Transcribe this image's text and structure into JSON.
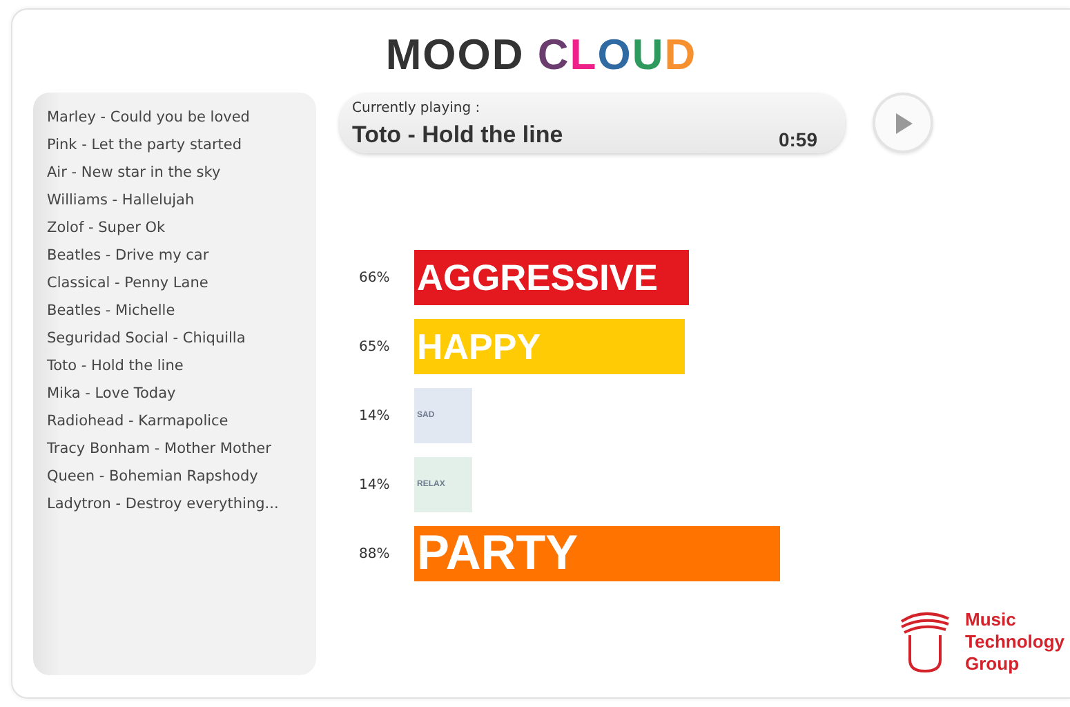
{
  "title": [
    {
      "text": "MOOD ",
      "color": "#333333"
    },
    {
      "text": "C",
      "color": "#6a3d6e"
    },
    {
      "text": "L",
      "color": "#f0208a"
    },
    {
      "text": "O",
      "color": "#2f6aa3"
    },
    {
      "text": "U",
      "color": "#2e9a5e"
    },
    {
      "text": "D",
      "color": "#f7912f"
    }
  ],
  "playlist": [
    "Marley - Could you be loved",
    "Pink - Let the party started",
    "Air - New  star in the sky",
    "Williams - Hallelujah",
    "Zolof - Super Ok",
    "Beatles - Drive my car",
    "Classical - Penny Lane",
    "Beatles - Michelle",
    "Seguridad Social - Chiquilla",
    "Toto - Hold the line",
    "Mika - Love Today",
    "Radiohead - Karmapolice",
    "Tracy Bonham - Mother Mother",
    "Queen - Bohemian Rapshody",
    "Ladytron - Destroy everything..."
  ],
  "now_playing": {
    "label": "Currently playing :",
    "track": "Toto - Hold the line",
    "time": "0:59"
  },
  "moods": [
    {
      "name": "AGGRESSIVE",
      "percent": "66%",
      "level": 0.66,
      "color": "#e3191f"
    },
    {
      "name": "HAPPY",
      "percent": "65%",
      "level": 0.65,
      "color": "#ffcb05"
    },
    {
      "name": "SAD",
      "percent": "14%",
      "level": 0.14,
      "color": "#e1e8f2"
    },
    {
      "name": "RELAX",
      "percent": "14%",
      "level": 0.14,
      "color": "#e2f0e9"
    },
    {
      "name": "PARTY",
      "percent": "88%",
      "level": 0.88,
      "color": "#ff7300"
    }
  ],
  "logo": {
    "lines": [
      "Music",
      "Technology",
      "Group"
    ]
  }
}
